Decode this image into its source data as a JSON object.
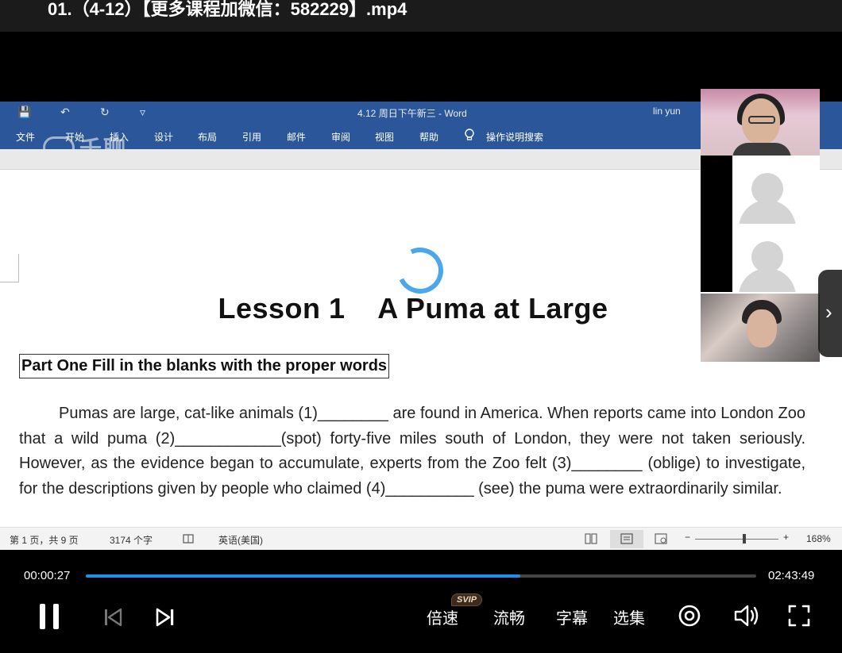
{
  "video_title": "01.（4-12）【更多课程加微信：582229】.mp4",
  "word": {
    "doc_title": "4.12 周日下午新三  -  Word",
    "user": "lin yun",
    "quick_access": {
      "save": "💾",
      "undo": "↶",
      "redo": "↻",
      "customize": "▿"
    },
    "menus": [
      "文件",
      "开始",
      "插入",
      "设计",
      "布局",
      "引用",
      "邮件",
      "审阅",
      "视图",
      "帮助"
    ],
    "search_hint": "操作说明搜索",
    "watermark": "千聊",
    "lesson_title": "Lesson 1    A Puma at Large",
    "part_heading": "Part One Fill in the blanks with the proper words",
    "paragraph": "Pumas are large, cat-like animals (1)________ are found in America. When reports came into London Zoo that a wild puma (2)____________(spot) forty-five miles south of London, they were not taken seriously. However, as the evidence began to accumulate, experts from the Zoo felt (3)________ (oblige) to investigate, for the descriptions given by people who claimed (4)__________ (see) the puma were extraordinarily similar.",
    "status": {
      "page": "第 1 页，共 9 页",
      "words": "3174 个字",
      "language": "英语(美国)",
      "zoom": "168%",
      "zoom_minus": "−",
      "zoom_plus": "+"
    }
  },
  "player": {
    "current_time": "00:00:27",
    "total_time": "02:43:49",
    "progress_fraction": 0.648,
    "speed_label": "倍速",
    "svip_badge": "SVIP",
    "quality_label": "流畅",
    "subtitle_label": "字幕",
    "episodes_label": "选集",
    "accent_color": "#1e90e8"
  }
}
